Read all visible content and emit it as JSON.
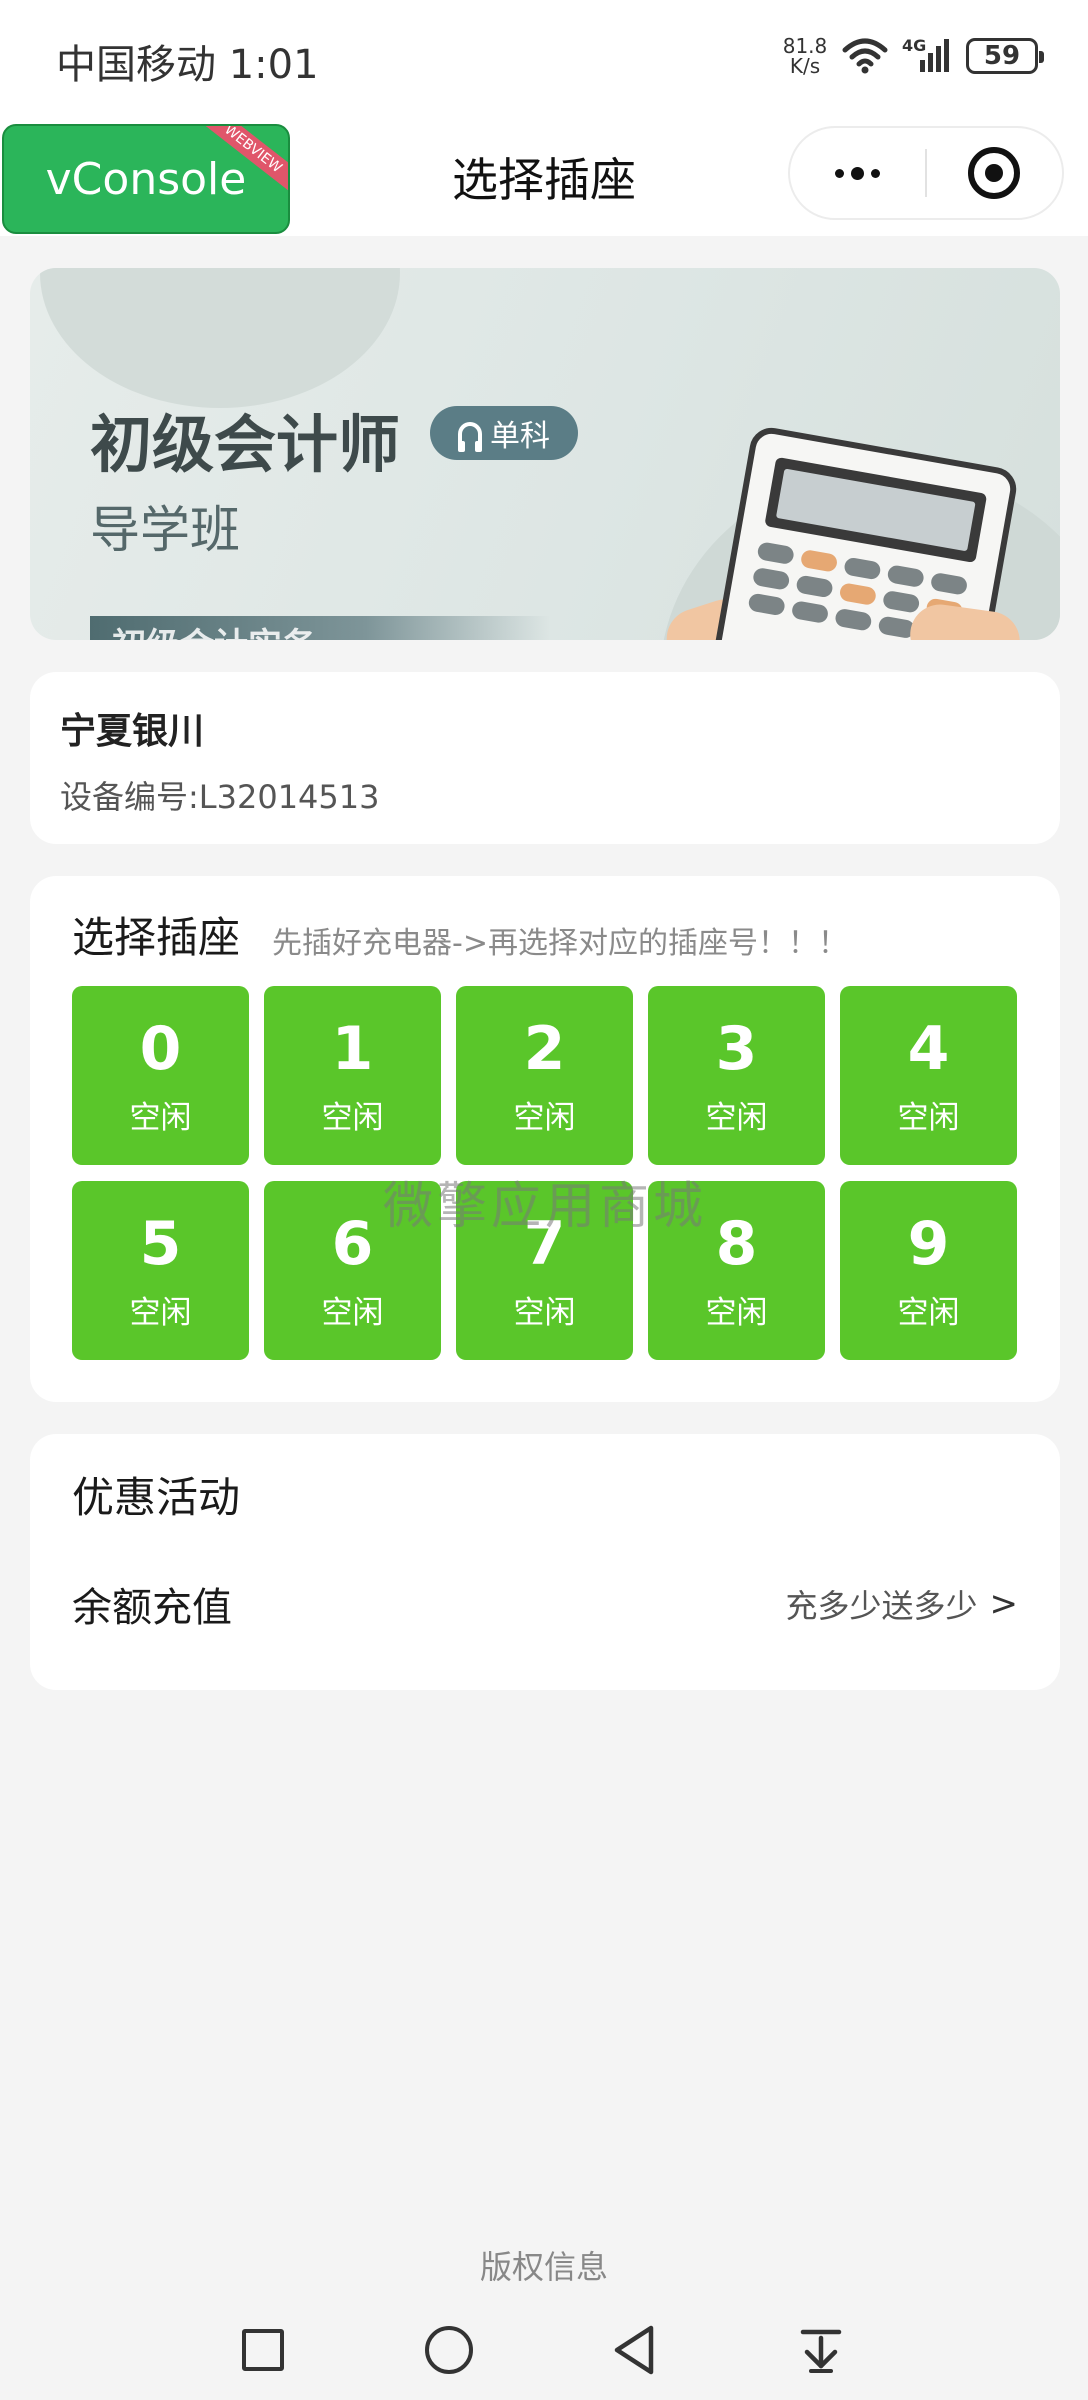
{
  "status_bar": {
    "carrier_time": "中国移动 1:01",
    "net_speed_value": "81.8",
    "net_speed_unit": "K/s",
    "network": "4G",
    "battery": "59"
  },
  "nav": {
    "vconsole_label": "vConsole",
    "vconsole_ribbon": "WEBVIEW",
    "title": "选择插座"
  },
  "banner": {
    "title": "初级会计师",
    "tag": "单科",
    "subtitle": "导学班",
    "strip_text": "初级会计实务"
  },
  "device": {
    "location": "宁夏银川",
    "id_text": "设备编号:L32014513"
  },
  "socket_section": {
    "title": "选择插座",
    "hint": "先插好充电器->再选择对应的插座号！！！",
    "sockets": [
      {
        "number": "0",
        "status": "空闲"
      },
      {
        "number": "1",
        "status": "空闲"
      },
      {
        "number": "2",
        "status": "空闲"
      },
      {
        "number": "3",
        "status": "空闲"
      },
      {
        "number": "4",
        "status": "空闲"
      },
      {
        "number": "5",
        "status": "空闲"
      },
      {
        "number": "6",
        "status": "空闲"
      },
      {
        "number": "7",
        "status": "空闲"
      },
      {
        "number": "8",
        "status": "空闲"
      },
      {
        "number": "9",
        "status": "空闲"
      }
    ],
    "watermark": "微擎应用商城"
  },
  "promo": {
    "title": "优惠活动",
    "item_label": "余额充值",
    "item_desc": "充多少送多少",
    "chevron": ">"
  },
  "footer": {
    "copyright": "版权信息"
  },
  "colors": {
    "socket_free": "#5ac62a",
    "vconsole_green": "#2bb55a",
    "page_bg": "#f4f4f4"
  },
  "icons": {
    "nav_more": "more-dots-icon",
    "nav_close": "target-icon",
    "sys_recent": "square-icon",
    "sys_home": "circle-icon",
    "sys_back": "triangle-back-icon",
    "sys_menu": "download-menu-icon"
  }
}
